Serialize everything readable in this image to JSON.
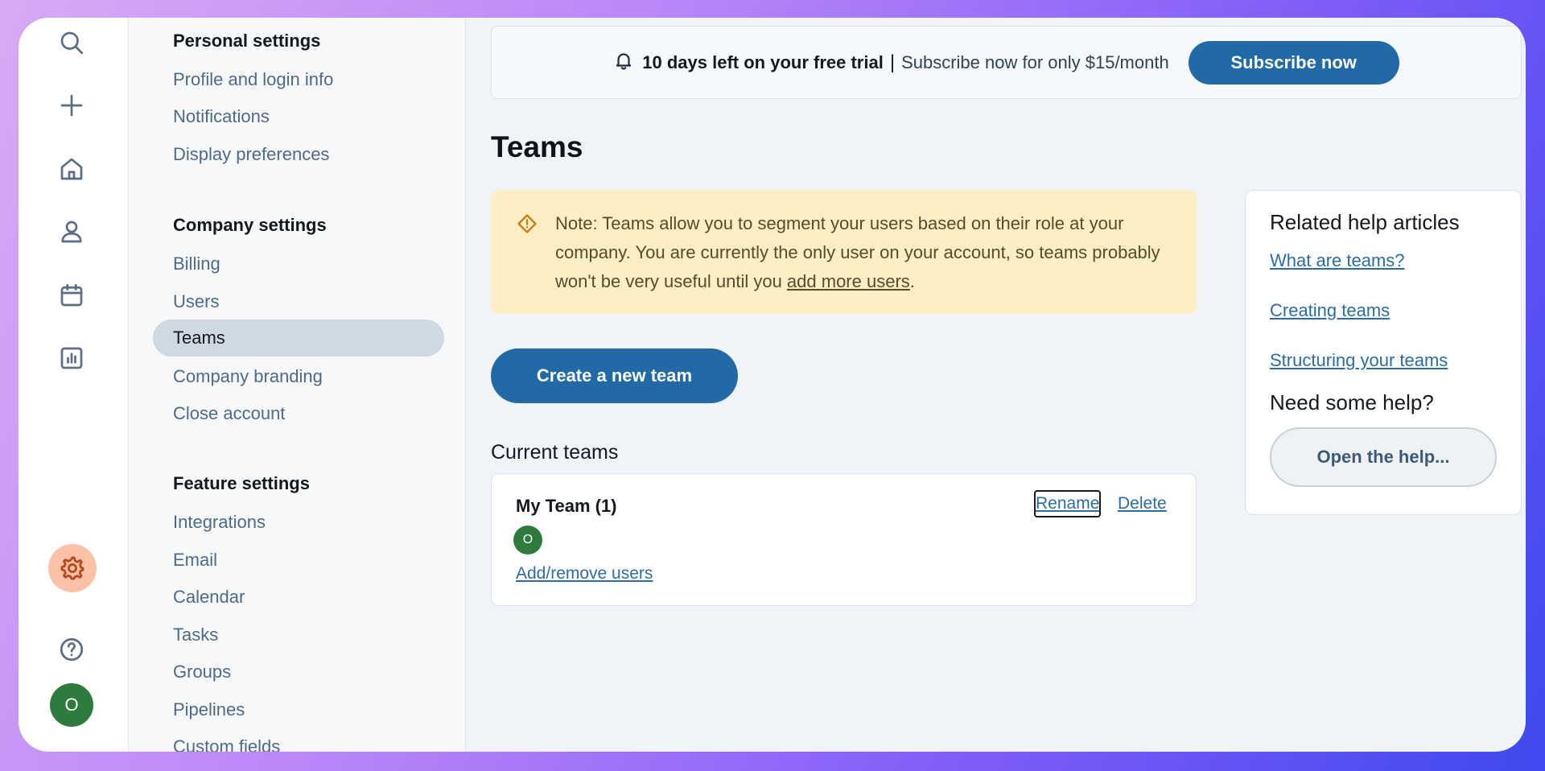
{
  "icons": {
    "rail": [
      "search-icon",
      "plus-icon",
      "home-icon",
      "person-icon",
      "calendar-icon",
      "chart-icon",
      "gear-icon",
      "help-icon"
    ],
    "banner": "bell-icon",
    "note": "warning-diamond-icon"
  },
  "user": {
    "initial": "O"
  },
  "settings_nav": {
    "personal_heading": "Personal settings",
    "personal_items": [
      "Profile and login info",
      "Notifications",
      "Display preferences"
    ],
    "company_heading": "Company settings",
    "company_items": [
      "Billing",
      "Users",
      "Teams",
      "Company branding",
      "Close account"
    ],
    "feature_heading": "Feature settings",
    "feature_items": [
      "Integrations",
      "Email",
      "Calendar",
      "Tasks",
      "Groups",
      "Pipelines",
      "Custom fields"
    ]
  },
  "trial_banner": {
    "bold_text": "10 days left on your free trial",
    "separator": "|",
    "text": "Subscribe now for only $15/month",
    "button_label": "Subscribe now"
  },
  "main": {
    "title": "Teams",
    "note_text": "Note: Teams allow you to segment your users based on their role at your company. You are currently the only user on your account, so teams probably won't be very useful until you ",
    "note_link": "add more users",
    "note_end": ".",
    "create_button": "Create a new team",
    "current_teams_title": "Current teams",
    "team": {
      "name": "My Team (1)",
      "member_initial": "O",
      "rename_label": "Rename",
      "delete_label": "Delete",
      "add_remove_label": "Add/remove users"
    }
  },
  "help_panel": {
    "title": "Related help articles",
    "links": [
      "What are teams?",
      "Creating teams",
      "Structuring your teams"
    ],
    "need_help_title": "Need some help?",
    "button_label": "Open the help..."
  },
  "colors": {
    "accent": "#216aa6",
    "active_nav_bg": "#cfd9e2",
    "note_bg": "#fdeec4",
    "avatar_green": "#2f7a3d",
    "gear_bg": "#fcc2a8"
  }
}
